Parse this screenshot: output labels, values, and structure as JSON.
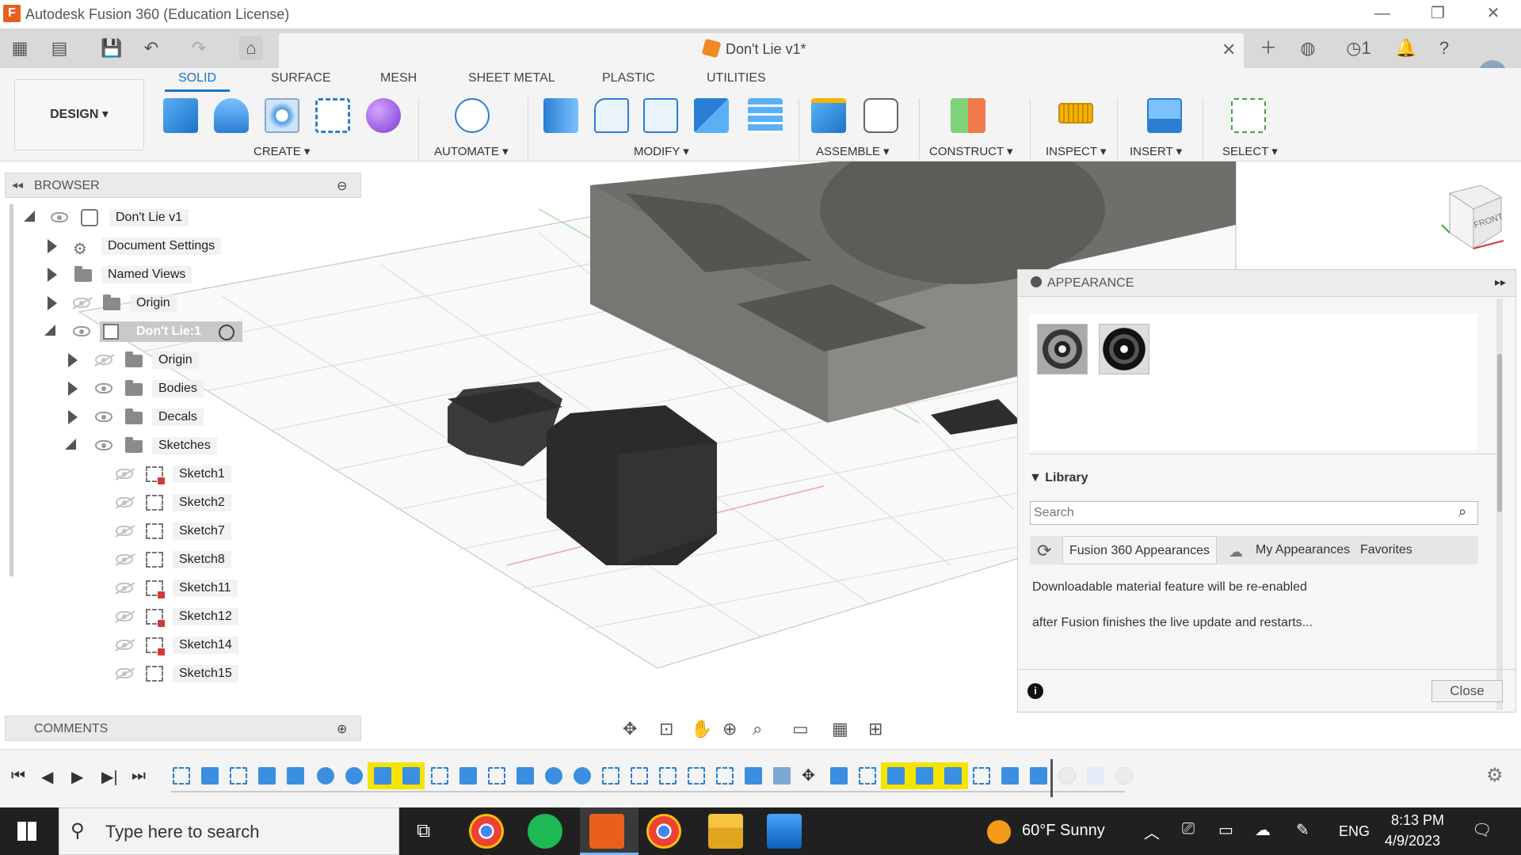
{
  "window": {
    "title": "Autodesk Fusion 360 (Education License)",
    "logo_letter": "F",
    "minimize": "—",
    "restore": "❐",
    "close": "✕"
  },
  "document_tab": {
    "title": "Don't Lie v1*",
    "close": "✕"
  },
  "ribbon": {
    "tabs": [
      "SOLID",
      "SURFACE",
      "MESH",
      "SHEET METAL",
      "PLASTIC",
      "UTILITIES"
    ],
    "workspace": "DESIGN ▾",
    "groups": [
      "CREATE ▾",
      "AUTOMATE ▾",
      "MODIFY ▾",
      "ASSEMBLE ▾",
      "CONSTRUCT ▾",
      "INSPECT ▾",
      "INSERT ▾",
      "SELECT ▾"
    ]
  },
  "browser": {
    "title": "BROWSER",
    "root": "Don't Lie v1",
    "items": {
      "document_settings": "Document Settings",
      "named_views": "Named Views",
      "origin": "Origin",
      "component": "Don't Lie:1",
      "comp_origin": "Origin",
      "bodies": "Bodies",
      "decals": "Decals",
      "sketches": "Sketches"
    },
    "sketches": [
      "Sketch1",
      "Sketch2",
      "Sketch7",
      "Sketch8",
      "Sketch11",
      "Sketch12",
      "Sketch14",
      "Sketch15"
    ]
  },
  "comments": {
    "title": "COMMENTS"
  },
  "viewcube": {
    "face": "FRONT"
  },
  "appearance": {
    "title": "APPEARANCE",
    "library_label": "Library",
    "search_placeholder": "Search",
    "tabs": [
      "Fusion 360 Appearances",
      "My Appearances",
      "Favorites"
    ],
    "message_line1": "Downloadable material feature will be re-enabled",
    "message_line2": "after Fusion finishes the live update and restarts...",
    "close_label": "Close",
    "info": "i"
  },
  "taskbar": {
    "search_placeholder": "Type here to search",
    "weather": "60°F  Sunny",
    "language": "ENG",
    "time": "8:13 PM",
    "date": "4/9/2023"
  },
  "colors": {
    "accent": "#1a73c8",
    "fusion_orange": "#e8601c",
    "body_gray": "#6f6e6a",
    "timeline_highlight": "#f5e400"
  }
}
